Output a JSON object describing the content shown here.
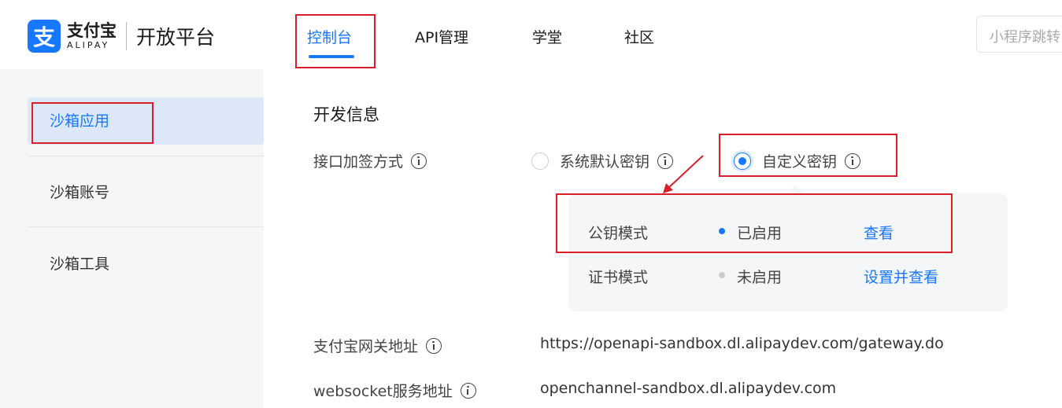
{
  "header": {
    "logo_mark": "支",
    "logo_cn": "支付宝",
    "logo_en": "ALIPAY",
    "platform": "开放平台",
    "nav": [
      "控制台",
      "API管理",
      "学堂",
      "社区"
    ],
    "search_placeholder": "小程序跳转"
  },
  "sidebar": {
    "items": [
      "沙箱应用",
      "沙箱账号",
      "沙箱工具"
    ]
  },
  "main": {
    "section_title": "开发信息",
    "sign_label": "接口加签方式",
    "sign_options": [
      "系统默认密钥",
      "自定义密钥"
    ],
    "modes": [
      {
        "name": "公钥模式",
        "status": "已启用",
        "action": "查看"
      },
      {
        "name": "证书模式",
        "status": "未启用",
        "action": "设置并查看"
      }
    ],
    "gateway_label": "支付宝网关地址",
    "gateway_value": "https://openapi-sandbox.dl.alipaydev.com/gateway.do",
    "websocket_label": "websocket服务地址",
    "websocket_value": "openchannel-sandbox.dl.alipaydev.com"
  },
  "colors": {
    "accent": "#1677ff",
    "annotation": "#d9202a",
    "status_on": "#1677ff",
    "status_off": "#cccccc"
  }
}
